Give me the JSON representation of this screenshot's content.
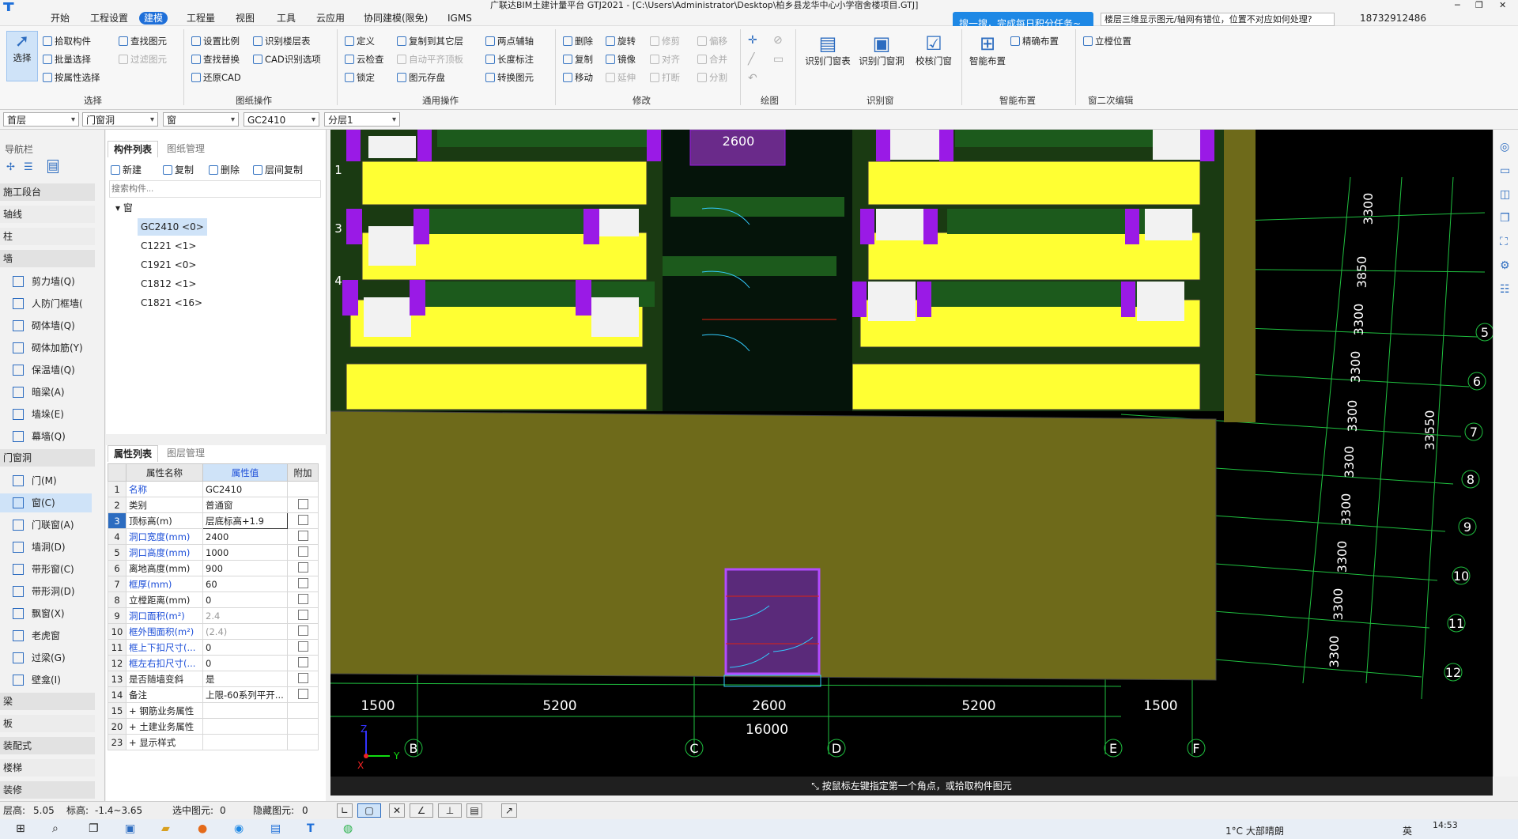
{
  "app": {
    "title": "广联达BIM土建计量平台 GTJ2021 - [C:\\Users\\Administrator\\Desktop\\柏乡县龙华中心小学宿舍楼项目.GTJ]",
    "help_query": "楼层三维显示图元/轴网有错位，位置不对应如何处理?",
    "user_phone": "18732912486",
    "tooltip": "搜一搜，完成每日积分任务~"
  },
  "menu": [
    "开始",
    "工程设置",
    "建模",
    "工程量",
    "视图",
    "工具",
    "云应用",
    "协同建模(限免)",
    "IGMS"
  ],
  "ribbon": {
    "select_label": "选择",
    "select_group": [
      "拾取构件",
      "批量选择",
      "按属性选择",
      "查找图元",
      "过滤图元"
    ],
    "select_group_title": "选择",
    "drawing_group": [
      "设置比例",
      "识别楼层表",
      "查找替换",
      "CAD识别选项",
      "还原CAD"
    ],
    "drawing_group_title": "图纸操作",
    "common_group": [
      "定义",
      "复制到其它层",
      "两点辅轴",
      "云检查",
      "自动平齐顶板",
      "长度标注",
      "锁定",
      "图元存盘",
      "转换图元"
    ],
    "common_group_title": "通用操作",
    "modify_group": [
      "删除",
      "旋转",
      "修剪",
      "偏移",
      "复制",
      "镜像",
      "对齐",
      "合并",
      "移动",
      "延伸",
      "打断",
      "分割"
    ],
    "modify_group_title": "修改",
    "draw_group_title": "绘图",
    "recognize_group": [
      "识别门窗表",
      "识别门窗洞",
      "校核门窗"
    ],
    "recognize_group_title": "识别窗",
    "smart_group": [
      "智能布置",
      "精确布置"
    ],
    "smart_group_title": "智能布置",
    "edit_group": [
      "立樘位置"
    ],
    "edit_group_title": "窗二次编辑"
  },
  "combos": [
    "首层",
    "门窗洞",
    "窗",
    "GC2410",
    "分层1"
  ],
  "nav": {
    "title": "导航栏",
    "categories": [
      "施工段台",
      "轴线",
      "柱",
      "墙",
      "门窗洞",
      "梁",
      "板",
      "装配式",
      "楼梯",
      "装修"
    ],
    "wall_items": [
      "剪力墙(Q)",
      "人防门框墙(",
      "砌体墙(Q)",
      "砌体加筋(Y)",
      "保温墙(Q)",
      "暗梁(A)",
      "墙垛(E)",
      "幕墙(Q)"
    ],
    "door_items": [
      "门(M)",
      "窗(C)",
      "门联窗(A)",
      "墙洞(D)",
      "带形窗(C)",
      "带形洞(D)",
      "飘窗(X)",
      "老虎窗",
      "过梁(G)",
      "壁龛(I)"
    ]
  },
  "component_list": {
    "tabs": [
      "构件列表",
      "图纸管理"
    ],
    "tools": [
      "新建",
      "复制",
      "删除",
      "层间复制"
    ],
    "search_placeholder": "搜索构件...",
    "root": "窗",
    "items": [
      "GC2410 <0>",
      "C1221 <1>",
      "C1921 <0>",
      "C1812 <1>",
      "C1821 <16>"
    ]
  },
  "properties": {
    "tabs": [
      "属性列表",
      "图层管理"
    ],
    "headers": [
      "属性名称",
      "属性值",
      "附加"
    ],
    "rows": [
      {
        "n": "1",
        "name": "名称",
        "value": "GC2410",
        "blue": true,
        "gray": false,
        "chk": false
      },
      {
        "n": "2",
        "name": "类别",
        "value": "普通窗",
        "blue": false,
        "gray": false,
        "chk": true
      },
      {
        "n": "3",
        "name": "顶标高(m)",
        "value": "层底标高+1.9",
        "blue": false,
        "gray": false,
        "chk": true
      },
      {
        "n": "4",
        "name": "洞口宽度(mm)",
        "value": "2400",
        "blue": true,
        "gray": false,
        "chk": true
      },
      {
        "n": "5",
        "name": "洞口高度(mm)",
        "value": "1000",
        "blue": true,
        "gray": false,
        "chk": true
      },
      {
        "n": "6",
        "name": "离地高度(mm)",
        "value": "900",
        "blue": false,
        "gray": false,
        "chk": true
      },
      {
        "n": "7",
        "name": "框厚(mm)",
        "value": "60",
        "blue": true,
        "gray": false,
        "chk": true
      },
      {
        "n": "8",
        "name": "立樘距离(mm)",
        "value": "0",
        "blue": false,
        "gray": false,
        "chk": true
      },
      {
        "n": "9",
        "name": "洞口面积(m²)",
        "value": "2.4",
        "blue": true,
        "gray": true,
        "chk": true
      },
      {
        "n": "10",
        "name": "框外围面积(m²)",
        "value": "(2.4)",
        "blue": true,
        "gray": true,
        "chk": true
      },
      {
        "n": "11",
        "name": "框上下扣尺寸(...",
        "value": "0",
        "blue": true,
        "gray": false,
        "chk": true
      },
      {
        "n": "12",
        "name": "框左右扣尺寸(...",
        "value": "0",
        "blue": true,
        "gray": false,
        "chk": true
      },
      {
        "n": "13",
        "name": "是否随墙变斜",
        "value": "是",
        "blue": false,
        "gray": false,
        "chk": true
      },
      {
        "n": "14",
        "name": "备注",
        "value": "上限-60系列平开...",
        "blue": false,
        "gray": false,
        "chk": true
      },
      {
        "n": "15",
        "name": "+ 钢筋业务属性",
        "value": "",
        "blue": false,
        "gray": false,
        "chk": false
      },
      {
        "n": "20",
        "name": "+ 土建业务属性",
        "value": "",
        "blue": false,
        "gray": false,
        "chk": false
      },
      {
        "n": "23",
        "name": "+ 显示样式",
        "value": "",
        "blue": false,
        "gray": false,
        "chk": false
      }
    ]
  },
  "viewport": {
    "top_dim": "2600",
    "bottom_dims": [
      "1500",
      "5200",
      "2600",
      "5200",
      "1500"
    ],
    "total_dim": "16000",
    "axis_letters": [
      "B",
      "C",
      "D",
      "E",
      "F"
    ],
    "axis_numbers": [
      "5",
      "6",
      "7",
      "8",
      "9",
      "10",
      "11",
      "12"
    ],
    "left_numbers": [
      "1",
      "3",
      "4"
    ],
    "right_dims": [
      "3300",
      "3850",
      "3300",
      "3300",
      "3300",
      "3300",
      "3300",
      "3300",
      "3300",
      "3300"
    ],
    "overall_right_dim": "33550",
    "axis_x": "X",
    "axis_y": "Y",
    "axis_z": "Z"
  },
  "status_message": "按鼠标左键指定第一个角点，或拾取构件图元",
  "statusbar": {
    "floor_height_label": "层高:",
    "floor_height": "5.05",
    "elevation_label": "标高:",
    "elevation": "-1.4~3.65",
    "selected_label": "选中图元:",
    "selected": "0",
    "hidden_label": "隐藏图元:",
    "hidden": "0"
  },
  "taskbar": {
    "weather": "1°C  大部晴朗",
    "lang": "英",
    "time": "14:53"
  }
}
